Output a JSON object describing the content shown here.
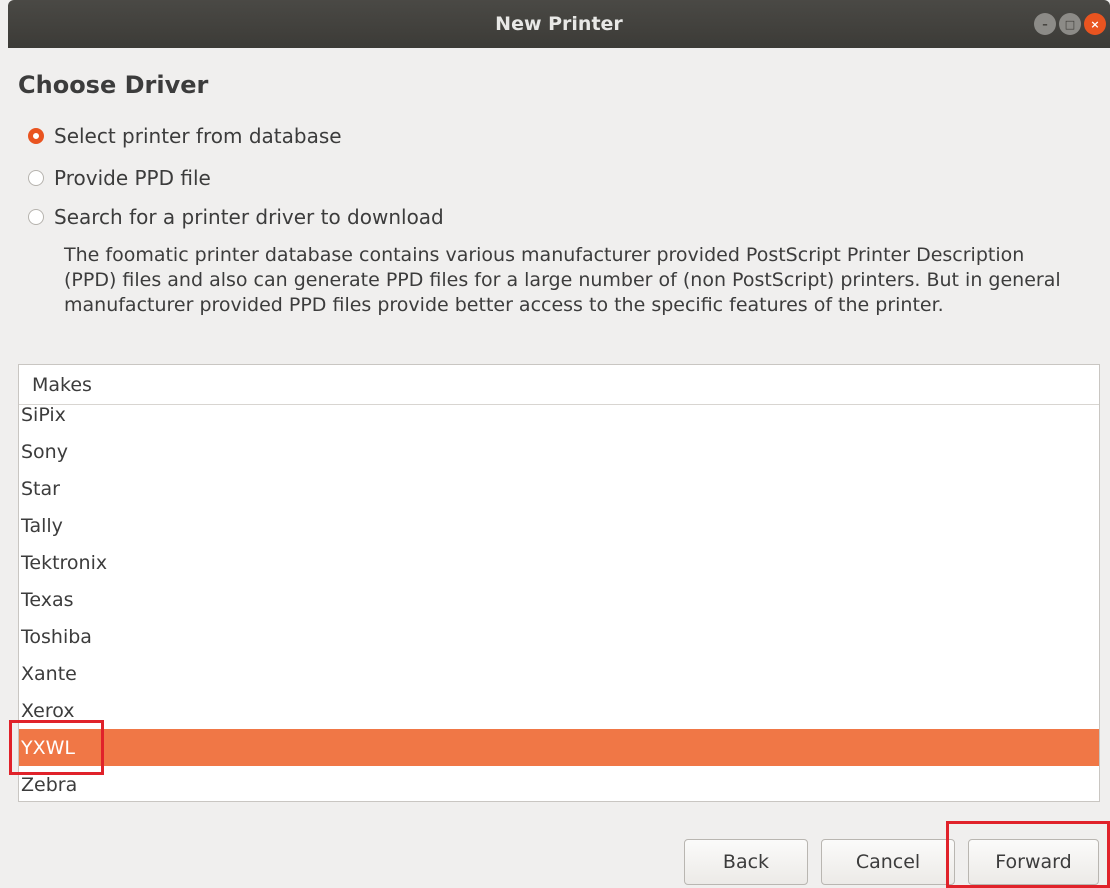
{
  "window": {
    "title": "New Printer"
  },
  "page": {
    "heading": "Choose Driver"
  },
  "options": [
    {
      "label": "Select printer from database",
      "selected": true
    },
    {
      "label": "Provide PPD file",
      "selected": false
    },
    {
      "label": "Search for a printer driver to download",
      "selected": false
    }
  ],
  "description": "The foomatic printer database contains various manufacturer provided PostScript Printer Description (PPD) files and also can generate PPD files for a large number of (non PostScript) printers. But in general manufacturer provided PPD files provide better access to the specific features of the printer.",
  "makes_list": {
    "header": "Makes",
    "items": [
      "SiPix",
      "Sony",
      "Star",
      "Tally",
      "Tektronix",
      "Texas",
      "Toshiba",
      "Xante",
      "Xerox",
      "YXWL",
      "Zebra"
    ],
    "selected": "YXWL"
  },
  "buttons": {
    "back": "Back",
    "cancel": "Cancel",
    "forward": "Forward"
  },
  "colors": {
    "accent": "#e95420",
    "selection": "#f07746",
    "highlight": "#e0222a"
  }
}
